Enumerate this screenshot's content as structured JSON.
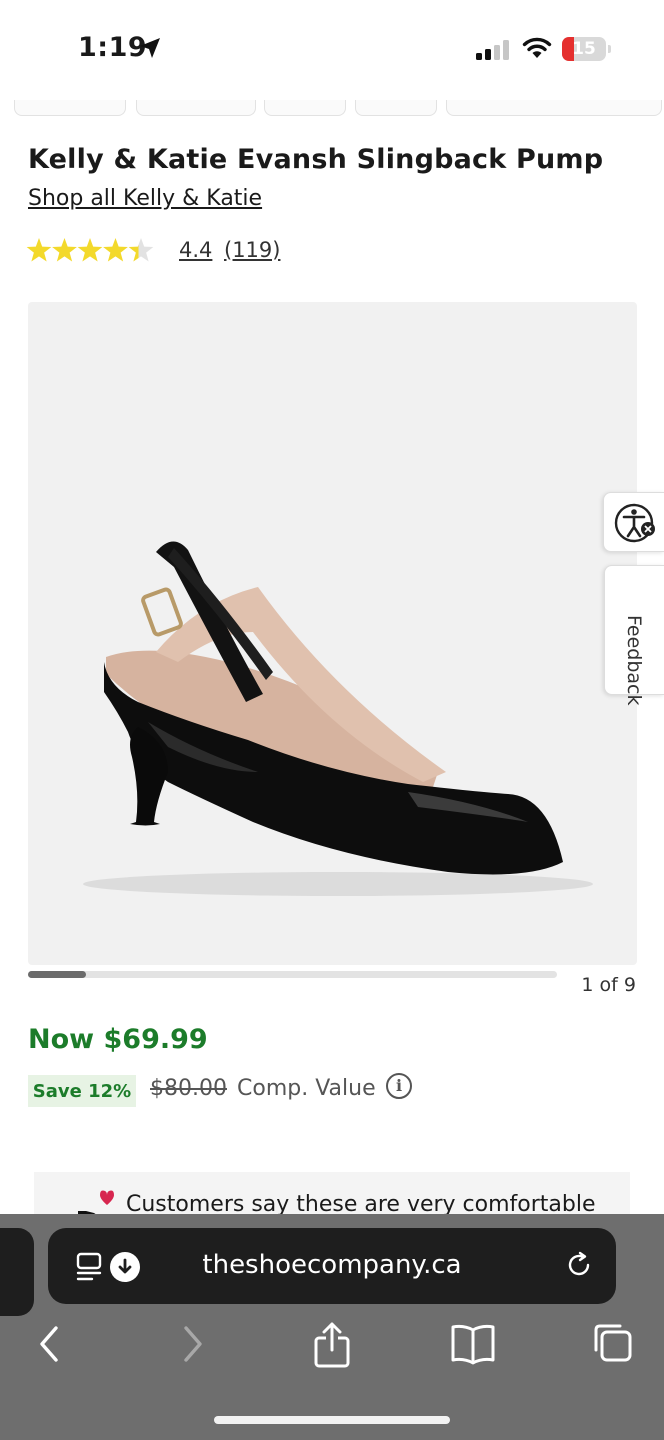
{
  "status_bar": {
    "time": "1:19",
    "battery": "15"
  },
  "product": {
    "title": "Kelly & Katie Evansh Slingback Pump",
    "shop_all": "Shop all Kelly & Katie",
    "rating": "4.4",
    "reviews": "(119)",
    "rating_value": 4.4,
    "image_counter": "1 of 9",
    "image_position_fraction": 0.11
  },
  "pricing": {
    "now": "Now $69.99",
    "save": "Save 12%",
    "old": "$80.00",
    "comp": "Comp. Value"
  },
  "comfort": {
    "text": "Customers say these are very comfortable"
  },
  "side_tabs": {
    "feedback": "Feedback"
  },
  "browser": {
    "url": "theshoecompany.ca"
  },
  "colors": {
    "price_green": "#1c7c2a",
    "star_yellow": "#f3d92b",
    "save_bg": "#e7f3e4"
  },
  "icons": [
    "location-arrow-icon",
    "signal-icon",
    "wifi-icon",
    "battery-icon",
    "star-icon",
    "accessibility-icon",
    "info-icon",
    "shoe-heart-icon",
    "reader-icon",
    "download-icon",
    "reload-icon",
    "back-icon",
    "forward-icon",
    "share-icon",
    "bookmarks-icon",
    "tabs-icon"
  ]
}
